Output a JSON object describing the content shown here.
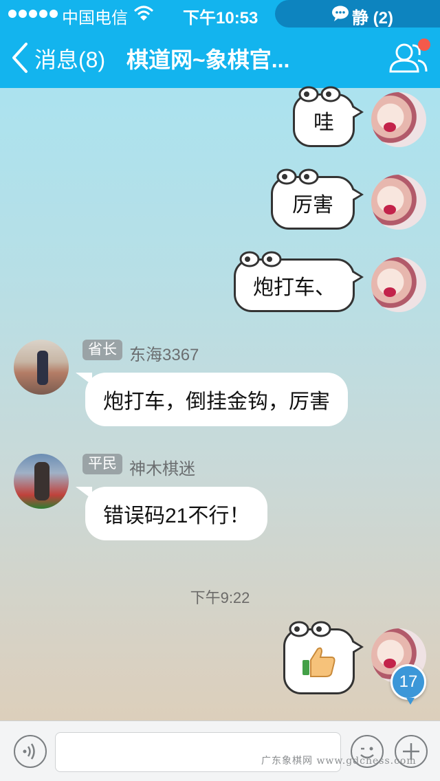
{
  "status_bar": {
    "carrier": "中国电信",
    "time": "下午10:53",
    "dnd_label": "静 (2)"
  },
  "nav": {
    "back_label": "消息(8)",
    "title": "棋道网~象棋官..."
  },
  "messages": {
    "mine_1": "哇",
    "mine_2": "厉害",
    "mine_3": "炮打车、",
    "in_1": {
      "rank": "省长",
      "sender": "东海3367",
      "text": "炮打车，倒挂金钩，厉害"
    },
    "in_2": {
      "rank": "平民",
      "sender": "神木棋迷",
      "text": "错误码21不行！"
    },
    "timestamp": "下午9:22",
    "unread_count": "17"
  },
  "input": {
    "placeholder": ""
  },
  "watermark": "广东象棋网 www.gdchess.com",
  "icons": [
    "signal-icon",
    "wifi-icon",
    "chat-bubble-icon",
    "back-chevron-icon",
    "group-members-icon",
    "voice-icon",
    "emoji-icon",
    "plus-icon",
    "thumbs-up-icon"
  ],
  "colors": {
    "nav_blue": "#13b4ee",
    "badge_red": "#f45a4b",
    "unread_blue": "#3c97d8"
  }
}
